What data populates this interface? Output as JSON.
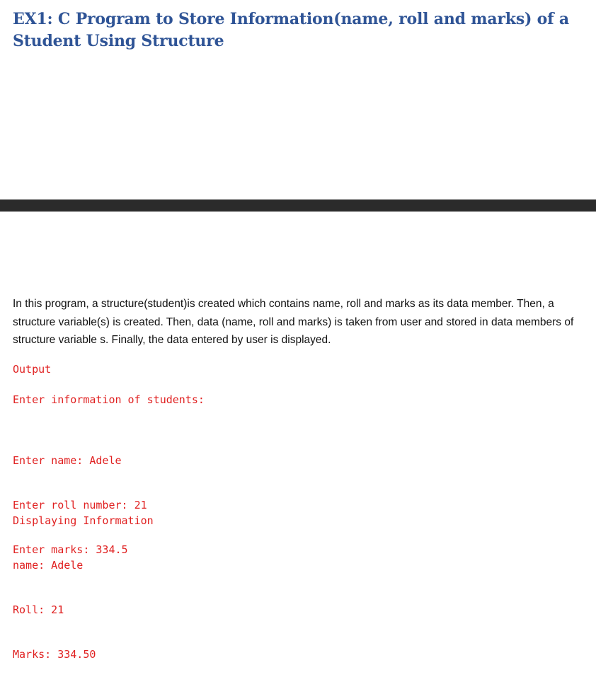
{
  "document": {
    "title": "EX1: C Program to Store Information(name, roll and marks) of a Student Using Structure",
    "description": "In this program, a structure(student)is created which contains name, roll and marks as its data member. Then, a structure variable(s) is created. Then, data (name, roll and marks) is taken from user and stored in data members of structure variable s. Finally, the data entered by user is displayed.",
    "output_label": "Output",
    "prompt": "Enter information of students:",
    "input_lines": [
      "Enter name: Adele",
      "Enter roll number: 21",
      "Enter marks: 334.5"
    ],
    "display_lines": [
      "Displaying Information",
      "name: Adele",
      "Roll: 21",
      "Marks: 334.50"
    ]
  },
  "colors": {
    "title": "#2f5496",
    "divider": "#2b2b2b",
    "code": "#e02020",
    "body_text": "#111111"
  }
}
